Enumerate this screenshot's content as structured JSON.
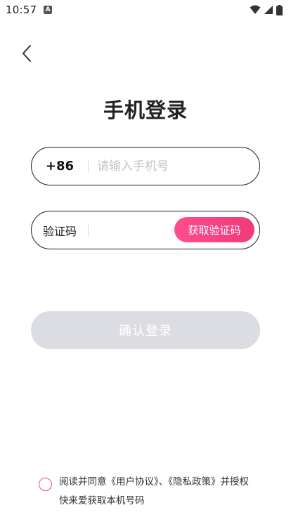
{
  "status_bar": {
    "time": "10:57",
    "notification_letter": "A",
    "icons": [
      "wifi-icon",
      "cell-signal-icon",
      "battery-icon"
    ]
  },
  "nav": {
    "back_icon": "chevron-left-icon"
  },
  "page": {
    "title": "手机登录"
  },
  "phone": {
    "country_code": "+86",
    "placeholder": "请输入手机号",
    "value": ""
  },
  "code": {
    "label": "验证码",
    "value": "",
    "get_code_label": "获取验证码"
  },
  "confirm": {
    "label": "确认登录"
  },
  "agreement": {
    "prefix": "阅读并同意",
    "user_agreement": "《用户协议》",
    "separator": "、",
    "privacy_policy": "《隐私政策》",
    "suffix": "并授权快来爱获取本机号码"
  },
  "colors": {
    "accent": "#f03a7a",
    "confirm_disabled": "#dcdde3",
    "border": "#1f1f1f",
    "placeholder": "#c4c4cc"
  }
}
